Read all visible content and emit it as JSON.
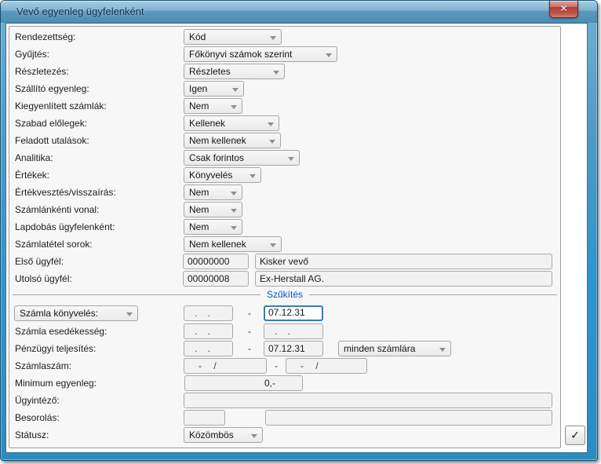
{
  "window": {
    "title": "Vevő egyenleg ügyfelenként"
  },
  "icons": {
    "close": "✕",
    "check": "✓",
    "dash": "-"
  },
  "top_rows": [
    {
      "label": "Rendezettség:",
      "value": "Kód"
    },
    {
      "label": "Gyűjtés:",
      "value": "Főkönyvi számok szerint"
    },
    {
      "label": "Részletezés:",
      "value": "Részletes"
    },
    {
      "label": "Szállító egyenleg:",
      "value": "Igen"
    },
    {
      "label": "Kiegyenlített számlák:",
      "value": "Nem"
    },
    {
      "label": "Szabad előlegek:",
      "value": "Kellenek"
    },
    {
      "label": "Feladott utalások:",
      "value": "Nem kellenek"
    },
    {
      "label": "Analitika:",
      "value": "Csak forintos"
    },
    {
      "label": "Értékek:",
      "value": "Könyvelés"
    },
    {
      "label": "Értékvesztés/visszaírás:",
      "value": "Nem"
    },
    {
      "label": "Számlánkénti vonal:",
      "value": "Nem"
    },
    {
      "label": "Lapdobás ügyfelenként:",
      "value": "Nem"
    },
    {
      "label": "Számlatétel sorok:",
      "value": "Nem kellenek"
    }
  ],
  "customer_range": {
    "first": {
      "label": "Első ügyfél:",
      "code": "00000000",
      "name": "Kisker vevő"
    },
    "last": {
      "label": "Utolsó ügyfél:",
      "code": "00000008",
      "name": "Ex-Herstall AG."
    }
  },
  "filter": {
    "legend": "Szűkítés",
    "booking": {
      "label": "Számla könyvelés:",
      "from": ". .",
      "to": "07.12.31"
    },
    "due": {
      "label": "Számla esedékesség:",
      "from": ". .",
      "to": ". ."
    },
    "payment": {
      "label": "Pénzügyi teljesítés:",
      "from": ". .",
      "to": "07.12.31",
      "scope": "minden számlára"
    },
    "invoice_number": {
      "label": "Számlaszám:",
      "from": "- /",
      "to": "- /"
    },
    "min_balance": {
      "label": "Minimum egyenleg:",
      "value": "0,-"
    },
    "clerk": {
      "label": "Ügyintéző:",
      "value": ""
    },
    "classification": {
      "label": "Besorolás:",
      "value1": "",
      "value2": ""
    },
    "status": {
      "label": "Státusz:",
      "value": "Közömbös"
    }
  },
  "colors": {
    "window_border_blue": "#2e96cc",
    "titlebar_blue": "#5d99bd",
    "legend_blue": "#0055d4",
    "close_red": "#ad4136",
    "focus_border": "#3c7bb7"
  }
}
